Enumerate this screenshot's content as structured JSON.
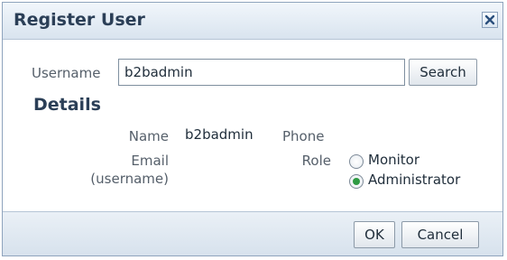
{
  "dialog": {
    "title": "Register User",
    "close_icon": "close-icon"
  },
  "search": {
    "label": "Username",
    "value": "b2badmin",
    "button_label": "Search"
  },
  "details": {
    "heading": "Details",
    "name_label": "Name",
    "name_value": "b2badmin",
    "phone_label": "Phone",
    "email_label_line1": "Email",
    "email_label_line2": "(username)",
    "role_label": "Role",
    "roles": [
      {
        "label": "Monitor",
        "selected": false
      },
      {
        "label": "Administrator",
        "selected": true
      }
    ]
  },
  "footer": {
    "ok_label": "OK",
    "cancel_label": "Cancel"
  },
  "colors": {
    "accent": "#2e9a43",
    "title_text": "#2b3f57"
  }
}
